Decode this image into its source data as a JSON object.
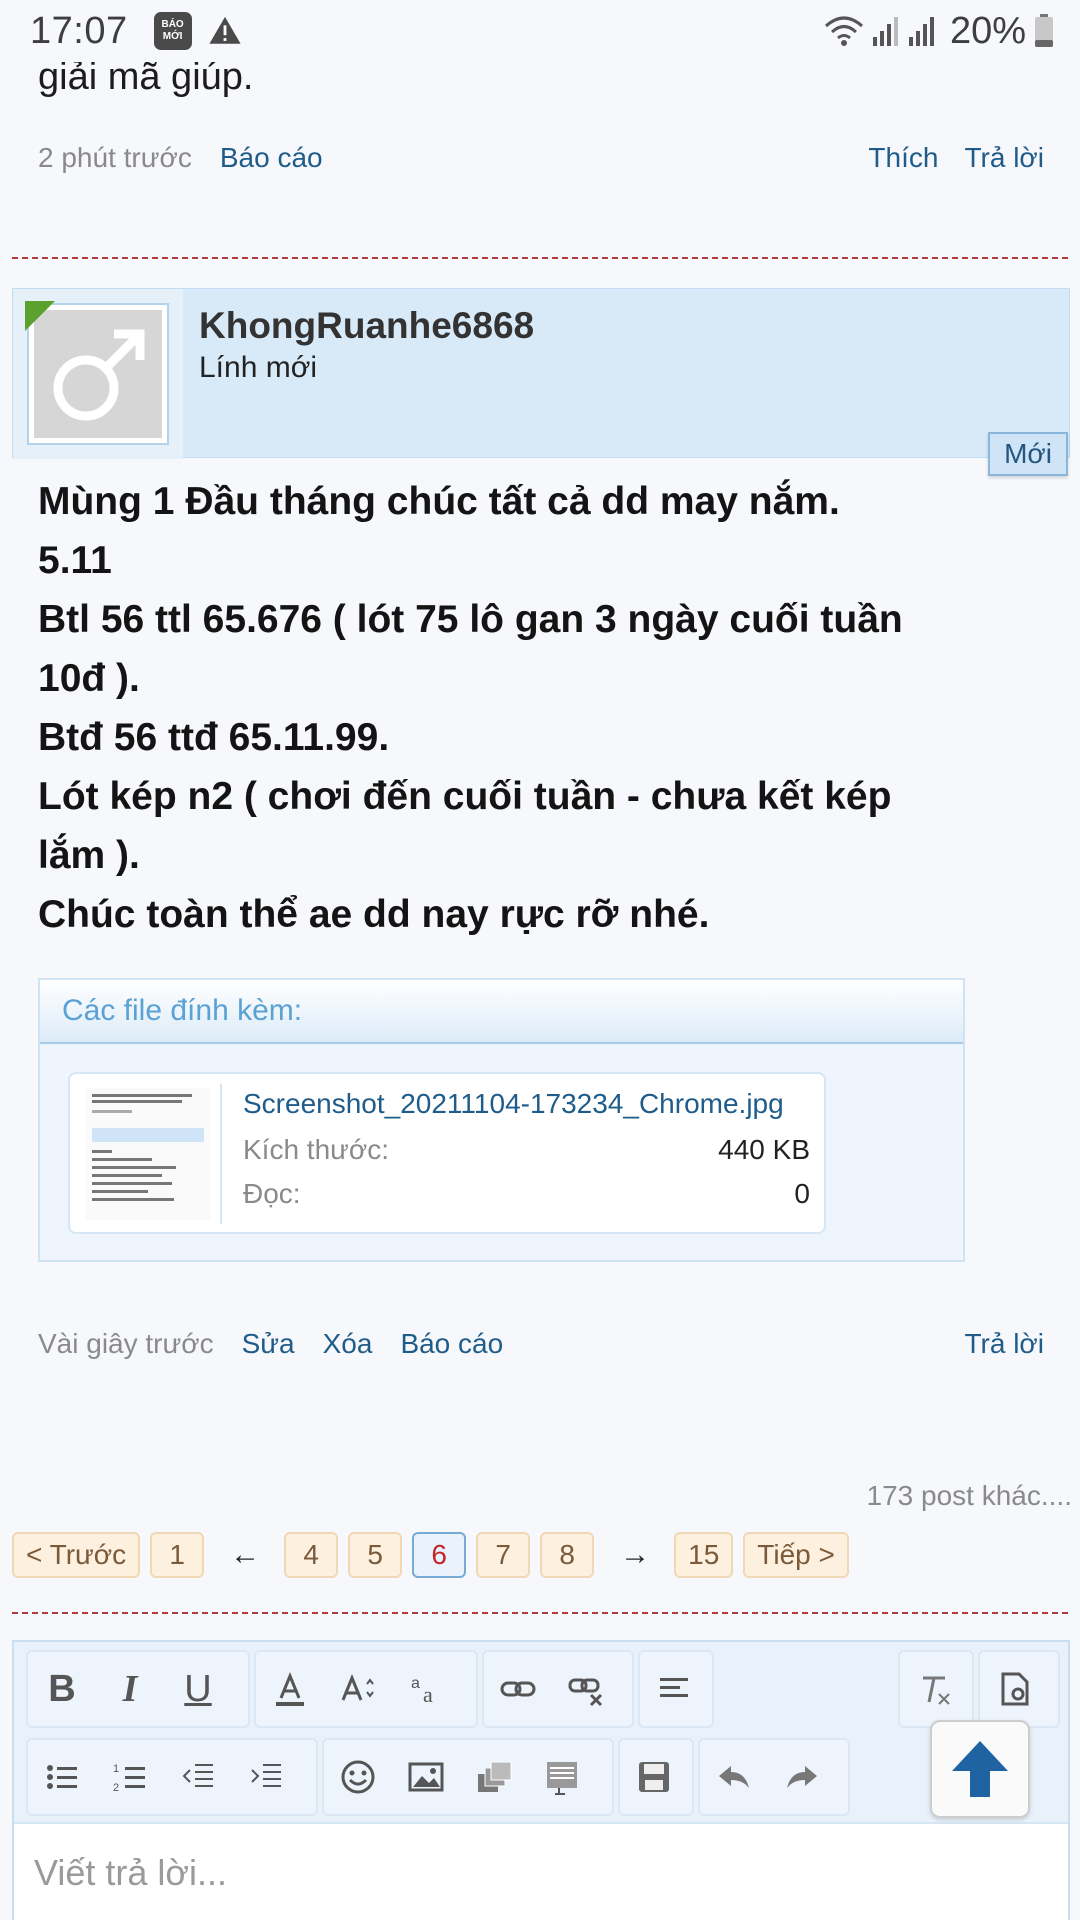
{
  "status_bar": {
    "time": "17:07",
    "app_icon_line1": "BÁO",
    "app_icon_line2": "MỚI",
    "battery": "20%"
  },
  "previous_post": {
    "text_tail": "giải mã giúp.",
    "time": "2 phút trước",
    "report": "Báo cáo",
    "like": "Thích",
    "reply": "Trả lời"
  },
  "post": {
    "author_name": "KhongRuanhe6868",
    "author_title": "Lính mới",
    "new_badge": "Mới",
    "lines": [
      "Mùng 1 Đầu tháng chúc tất cả dd may nắm.",
      "5.11",
      "Btl 56 ttl 65.676 ( lót 75 lô gan 3 ngày cuối tuần",
      "10đ ).",
      "Btđ 56 ttđ 65.11.99.",
      "Lót kép n2 ( chơi đến cuối tuần - chưa kết kép",
      "lắm ).",
      "Chúc toàn thể ae dd nay rực rỡ nhé."
    ],
    "attachments": {
      "heading": "Các file đính kèm:",
      "file_name": "Screenshot_20211104-173234_Chrome.jpg",
      "size_label": "Kích thước:",
      "size_value": "440 KB",
      "views_label": "Đọc:",
      "views_value": "0"
    },
    "actions": {
      "time": "Vài giây trước",
      "edit": "Sửa",
      "delete": "Xóa",
      "report": "Báo cáo",
      "reply": "Trả lời"
    }
  },
  "pagination": {
    "more_posts": "173 post khác....",
    "prev": "< Trước",
    "first": "1",
    "left_arrow": "←",
    "pages": [
      "4",
      "5",
      "6",
      "7",
      "8"
    ],
    "current": "6",
    "right_arrow": "→",
    "last": "15",
    "next": "Tiếp >"
  },
  "editor": {
    "placeholder": "Viết trả lời...",
    "bold": "B",
    "italic": "I",
    "underline": "U"
  },
  "colors": {
    "link": "#1f5c8a",
    "separator": "#b23a3a",
    "author_header_bg": "#d8e9f8",
    "page_btn_bg": "#fdf0de",
    "current_page_text": "#c0262b"
  }
}
